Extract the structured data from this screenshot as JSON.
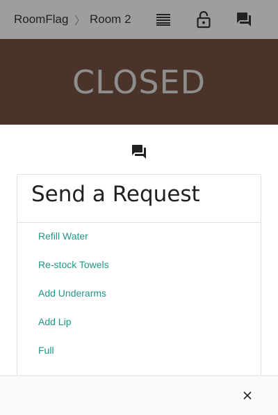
{
  "header": {
    "app_name": "RoomFlag",
    "separator": "〉",
    "room_name": "Room 2",
    "icons": [
      "list-icon",
      "lock-open-icon",
      "chat-icon"
    ]
  },
  "status": {
    "label": "CLOSED",
    "background": "#4a3429",
    "text_color": "#8e8e8e"
  },
  "request_card": {
    "title": "Send a Request",
    "items": [
      {
        "label": "Refill Water"
      },
      {
        "label": "Re-stock Towels"
      },
      {
        "label": "Add Underarms"
      },
      {
        "label": "Add Lip"
      },
      {
        "label": "Full"
      }
    ],
    "link_color": "#1e9688"
  },
  "footer": {
    "close_icon": "close-icon"
  }
}
